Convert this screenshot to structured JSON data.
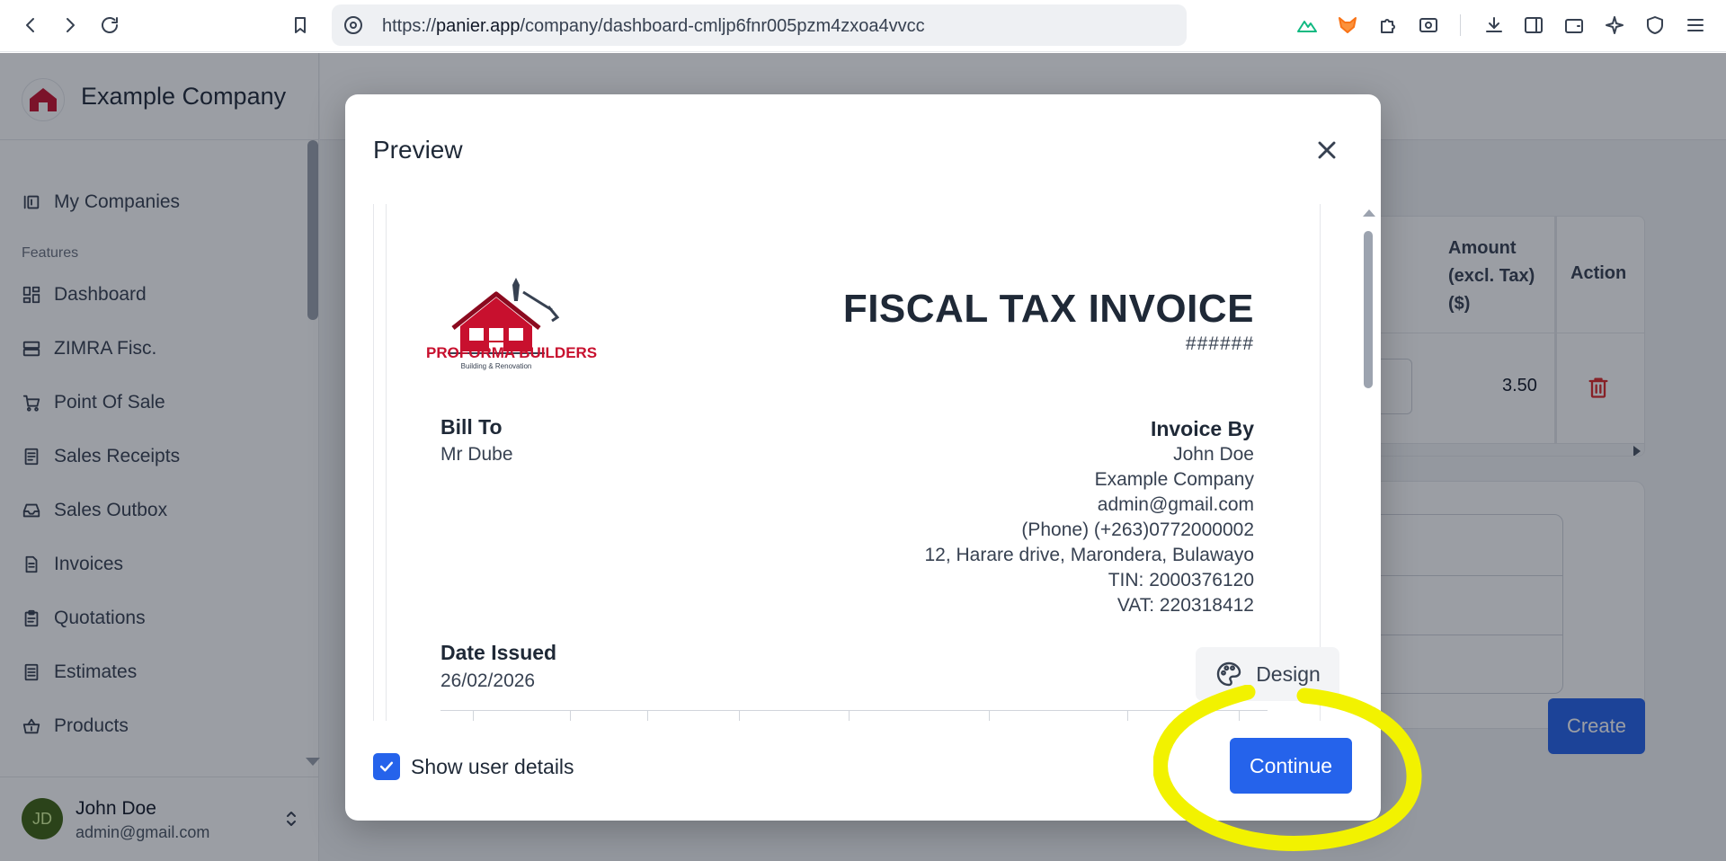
{
  "browser": {
    "url_prefix": "https://",
    "url_host": "panier.app",
    "url_path": "/company/dashboard-cmljp6fnr005pzm4zxoa4vvcc"
  },
  "sidebar": {
    "company_name": "Example Company",
    "my_companies": "My Companies",
    "section_label": "Features",
    "items": [
      {
        "label": "Dashboard"
      },
      {
        "label": "ZIMRA Fisc."
      },
      {
        "label": "Point Of Sale"
      },
      {
        "label": "Sales Receipts"
      },
      {
        "label": "Sales Outbox"
      },
      {
        "label": "Invoices"
      },
      {
        "label": "Quotations"
      },
      {
        "label": "Estimates"
      },
      {
        "label": "Products"
      }
    ],
    "user": {
      "initials": "JD",
      "name": "John Doe",
      "email": "admin@gmail.com"
    }
  },
  "main": {
    "table": {
      "amount_header": "Amount (excl. Tax) ($)",
      "action_header": "Action",
      "row_amount": "3.50"
    },
    "create_label": "Create"
  },
  "modal": {
    "title": "Preview",
    "invoice": {
      "logo_name": "PROFORMA BUILDERS",
      "logo_tagline": "Building & Renovation",
      "title": "FISCAL TAX INVOICE",
      "number": "######",
      "bill_to_label": "Bill To",
      "bill_to_name": "Mr Dube",
      "invoice_by_label": "Invoice By",
      "invoice_by_lines": [
        "John Doe",
        "Example Company",
        "admin@gmail.com",
        "(Phone) (+263)0772000002",
        "12, Harare drive, Marondera, Bulawayo",
        "TIN: 2000376120",
        "VAT: 220318412"
      ],
      "date_label": "Date Issued",
      "date_value": "26/02/2026"
    },
    "design_label": "Design",
    "show_user_details_label": "Show user details",
    "show_user_details_checked": true,
    "continue_label": "Continue"
  },
  "colors": {
    "primary": "#2563eb",
    "highlight": "#f2f200",
    "logo_red": "#c8102e"
  }
}
